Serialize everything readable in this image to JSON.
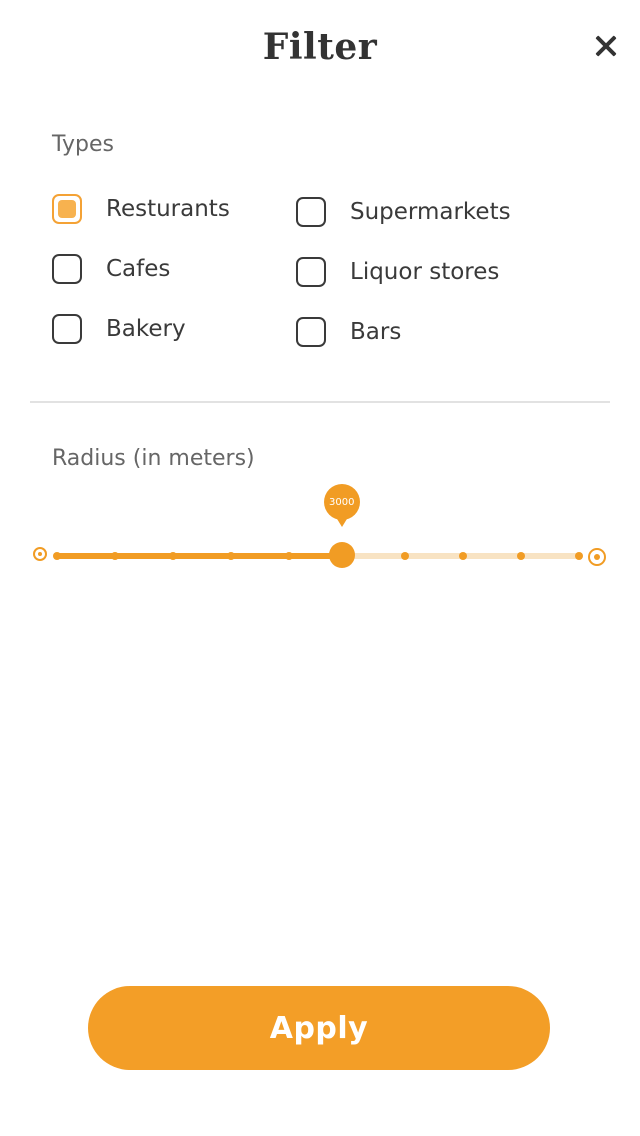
{
  "header": {
    "title": "Filter",
    "close_icon": "close-icon"
  },
  "types": {
    "label": "Types",
    "options": [
      {
        "label": "Resturants",
        "checked": true
      },
      {
        "label": "Supermarkets",
        "checked": false
      },
      {
        "label": "Cafes",
        "checked": false
      },
      {
        "label": "Liquor stores",
        "checked": false
      },
      {
        "label": "Bakery",
        "checked": false
      },
      {
        "label": "Bars",
        "checked": false
      }
    ]
  },
  "radius": {
    "label": "Radius (in meters)",
    "value_label": "3000",
    "fill_fraction": 0.545,
    "tick_count": 10
  },
  "footer": {
    "apply_label": "Apply"
  },
  "colors": {
    "accent": "#f39e27",
    "track_light": "#f8e3c3"
  }
}
